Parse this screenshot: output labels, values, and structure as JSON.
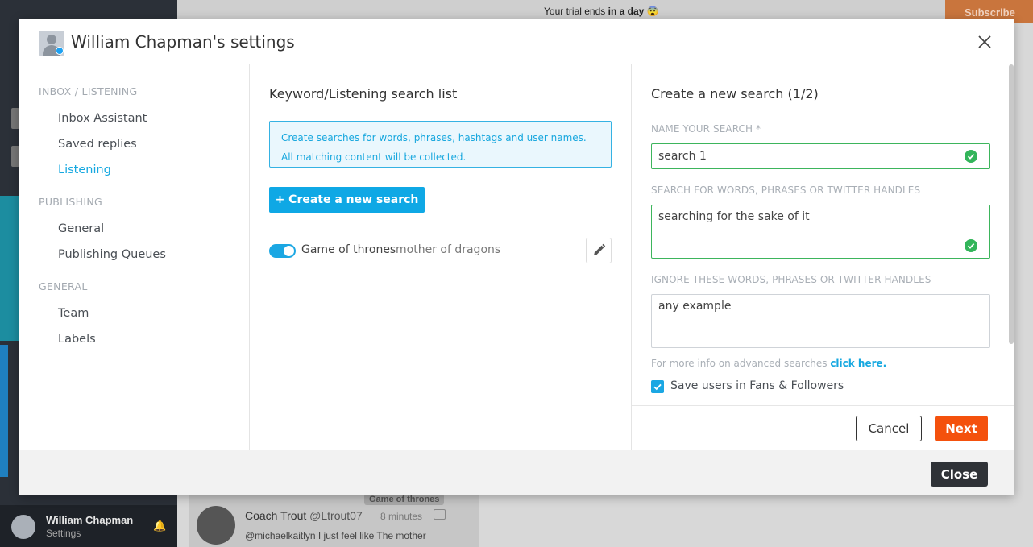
{
  "background": {
    "trial_text": "Your trial ends",
    "trial_bold": "in a day",
    "trial_emoji": "😨",
    "subscribe_label": "Subscribe",
    "user_name": "William Chapman",
    "user_sub": "Settings",
    "feed": {
      "tag": "Game of thrones",
      "author": "Coach Trout",
      "handle": "@Ltrout07",
      "time": "8 minutes",
      "text": "@michaelkaitlyn I just feel like The mother"
    }
  },
  "modal": {
    "title": "William Chapman's settings",
    "close_label": "Close"
  },
  "nav": {
    "sections": [
      {
        "label": "INBOX / LISTENING",
        "items": [
          "Inbox Assistant",
          "Saved replies",
          "Listening"
        ]
      },
      {
        "label": "PUBLISHING",
        "items": [
          "General",
          "Publishing Queues"
        ]
      },
      {
        "label": "GENERAL",
        "items": [
          "Team",
          "Labels"
        ]
      }
    ],
    "active": "Listening"
  },
  "search_list": {
    "title": "Keyword/Listening search list",
    "info": "Create searches for words, phrases, hashtags and user names. All matching content will be collected.",
    "create_label": "+ Create a new search",
    "items": [
      {
        "name": "Game of thrones",
        "terms": "mother of dragons",
        "enabled": true
      }
    ]
  },
  "new_search": {
    "title": "Create a new search (1/2)",
    "name_label": "NAME YOUR SEARCH *",
    "name_value": "search 1",
    "words_label": "SEARCH FOR WORDS, PHRASES OR TWITTER HANDLES",
    "words_value": "searching for the sake of it",
    "ignore_label": "IGNORE THESE WORDS, PHRASES OR TWITTER HANDLES",
    "ignore_value": "any example",
    "help_text": "For more info on advanced searches",
    "help_link": "click here.",
    "save_users_label": "Save users in Fans & Followers",
    "save_users_checked": true,
    "cancel_label": "Cancel",
    "next_label": "Next"
  },
  "colors": {
    "accent": "#16a8e0",
    "next": "#f4510d",
    "valid": "#3db55c",
    "close_button": "#2f3237"
  }
}
